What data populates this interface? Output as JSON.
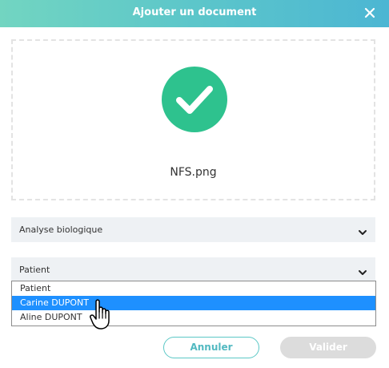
{
  "dialog": {
    "title": "Ajouter un document",
    "close_icon": "close-icon"
  },
  "dropzone": {
    "status_icon": "check-circle-icon",
    "filename": "NFS.png"
  },
  "document_type_select": {
    "value": "Analyse biologique",
    "icon": "chevron-down-icon"
  },
  "patient_select": {
    "value": "Patient",
    "icon": "chevron-down-icon",
    "options": [
      "Patient",
      "Carine DUPONT",
      "Aline DUPONT"
    ],
    "highlighted_index": 1
  },
  "buttons": {
    "cancel": "Annuler",
    "validate": "Valider"
  },
  "colors": {
    "header_start": "#72d5c1",
    "header_end": "#4cb6d3",
    "success": "#2ec28e",
    "highlight": "#1e90ff"
  }
}
